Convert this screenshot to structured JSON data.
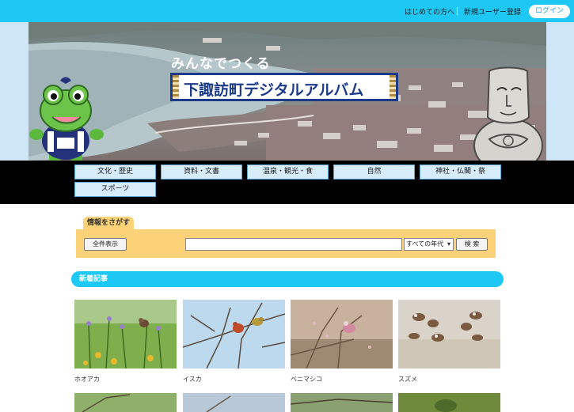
{
  "header": {
    "links": [
      "はじめての方へ",
      "新規ユーザー登録"
    ],
    "login_label": "ログイン"
  },
  "hero": {
    "tagline": "みんなでつくる",
    "title": "下諏訪町デジタルアルバム"
  },
  "nav": {
    "items": [
      "文化・歴史",
      "資料・文書",
      "温泉・観光・食",
      "自然",
      "神社・仏閣・祭",
      "スポーツ"
    ]
  },
  "search": {
    "tab_label": "情報をさがす",
    "show_all_label": "全件表示",
    "keyword_value": "",
    "era_selected": "すべての年代",
    "search_label": "検 索"
  },
  "new_articles": {
    "heading": "新着記事",
    "items": [
      {
        "title": "ホオアカ"
      },
      {
        "title": "イスカ"
      },
      {
        "title": "ベニマシコ"
      },
      {
        "title": "スズメ"
      },
      {
        "title": ""
      },
      {
        "title": ""
      },
      {
        "title": ""
      },
      {
        "title": ""
      }
    ]
  },
  "colors": {
    "accent": "#1ec8f5",
    "search_panel": "#fbd277",
    "nav_band": "#000000",
    "title_blue": "#1b3a8a"
  }
}
